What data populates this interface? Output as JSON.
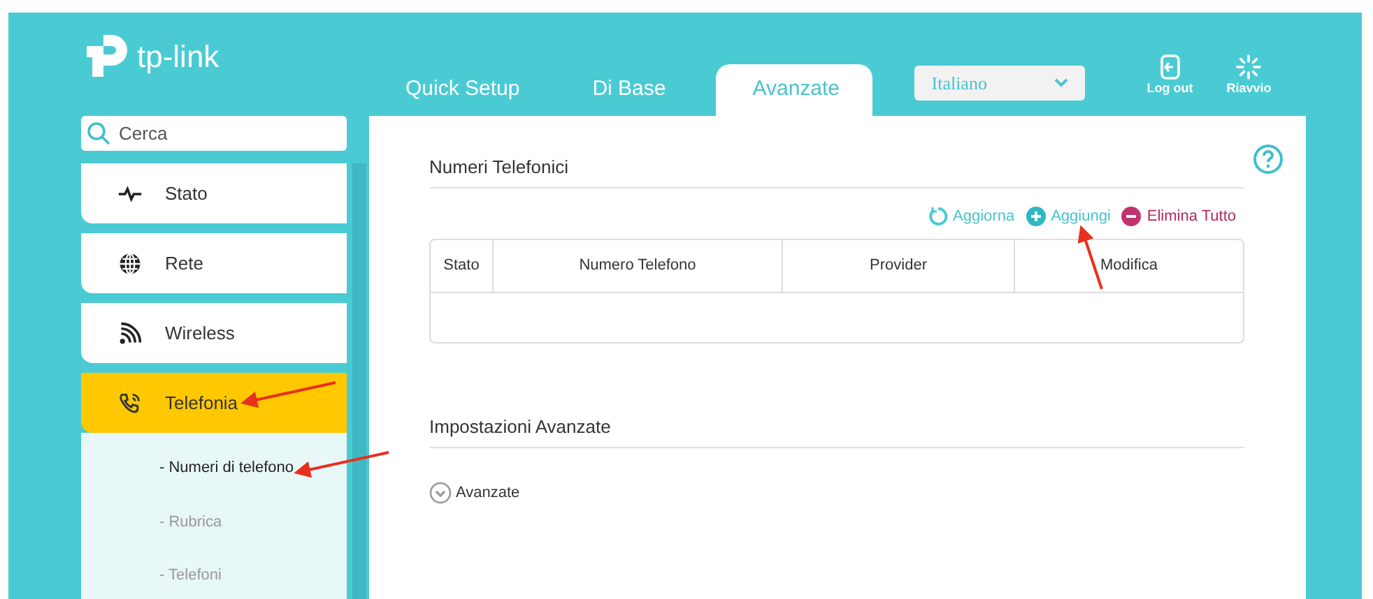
{
  "logo": {
    "text": "tp-link"
  },
  "tabs": [
    {
      "label": "Quick Setup",
      "selected": false
    },
    {
      "label": "Di Base",
      "selected": false
    },
    {
      "label": "Avanzate",
      "selected": true
    }
  ],
  "language": {
    "value": "Italiano"
  },
  "header_actions": [
    {
      "label": "Log out",
      "kind": "logout"
    },
    {
      "label": "Riavvio",
      "kind": "reboot"
    }
  ],
  "search": {
    "placeholder": "Cerca"
  },
  "menu": [
    {
      "label": "Stato",
      "kind": "status",
      "selected": false
    },
    {
      "label": "Rete",
      "kind": "network",
      "selected": false
    },
    {
      "label": "Wireless",
      "kind": "wireless",
      "selected": false
    },
    {
      "label": "Telefonia",
      "kind": "phone",
      "selected": true,
      "children": [
        {
          "label": "- Numeri di telefono",
          "selected": true
        },
        {
          "label": "- Rubrica",
          "selected": false
        },
        {
          "label": "- Telefoni",
          "selected": false
        }
      ]
    }
  ],
  "phone_numbers": {
    "title": "Numeri Telefonici",
    "actions": [
      {
        "label": "Aggiorna",
        "kind": "refresh"
      },
      {
        "label": "Aggiungi",
        "kind": "add"
      },
      {
        "label": "Elimina Tutto",
        "kind": "delete"
      }
    ],
    "columns": [
      "Stato",
      "Numero Telefono",
      "Provider",
      "Modifica"
    ]
  },
  "advanced": {
    "title": "Impostazioni Avanzate",
    "toggle": {
      "label": "Avanzate"
    }
  }
}
